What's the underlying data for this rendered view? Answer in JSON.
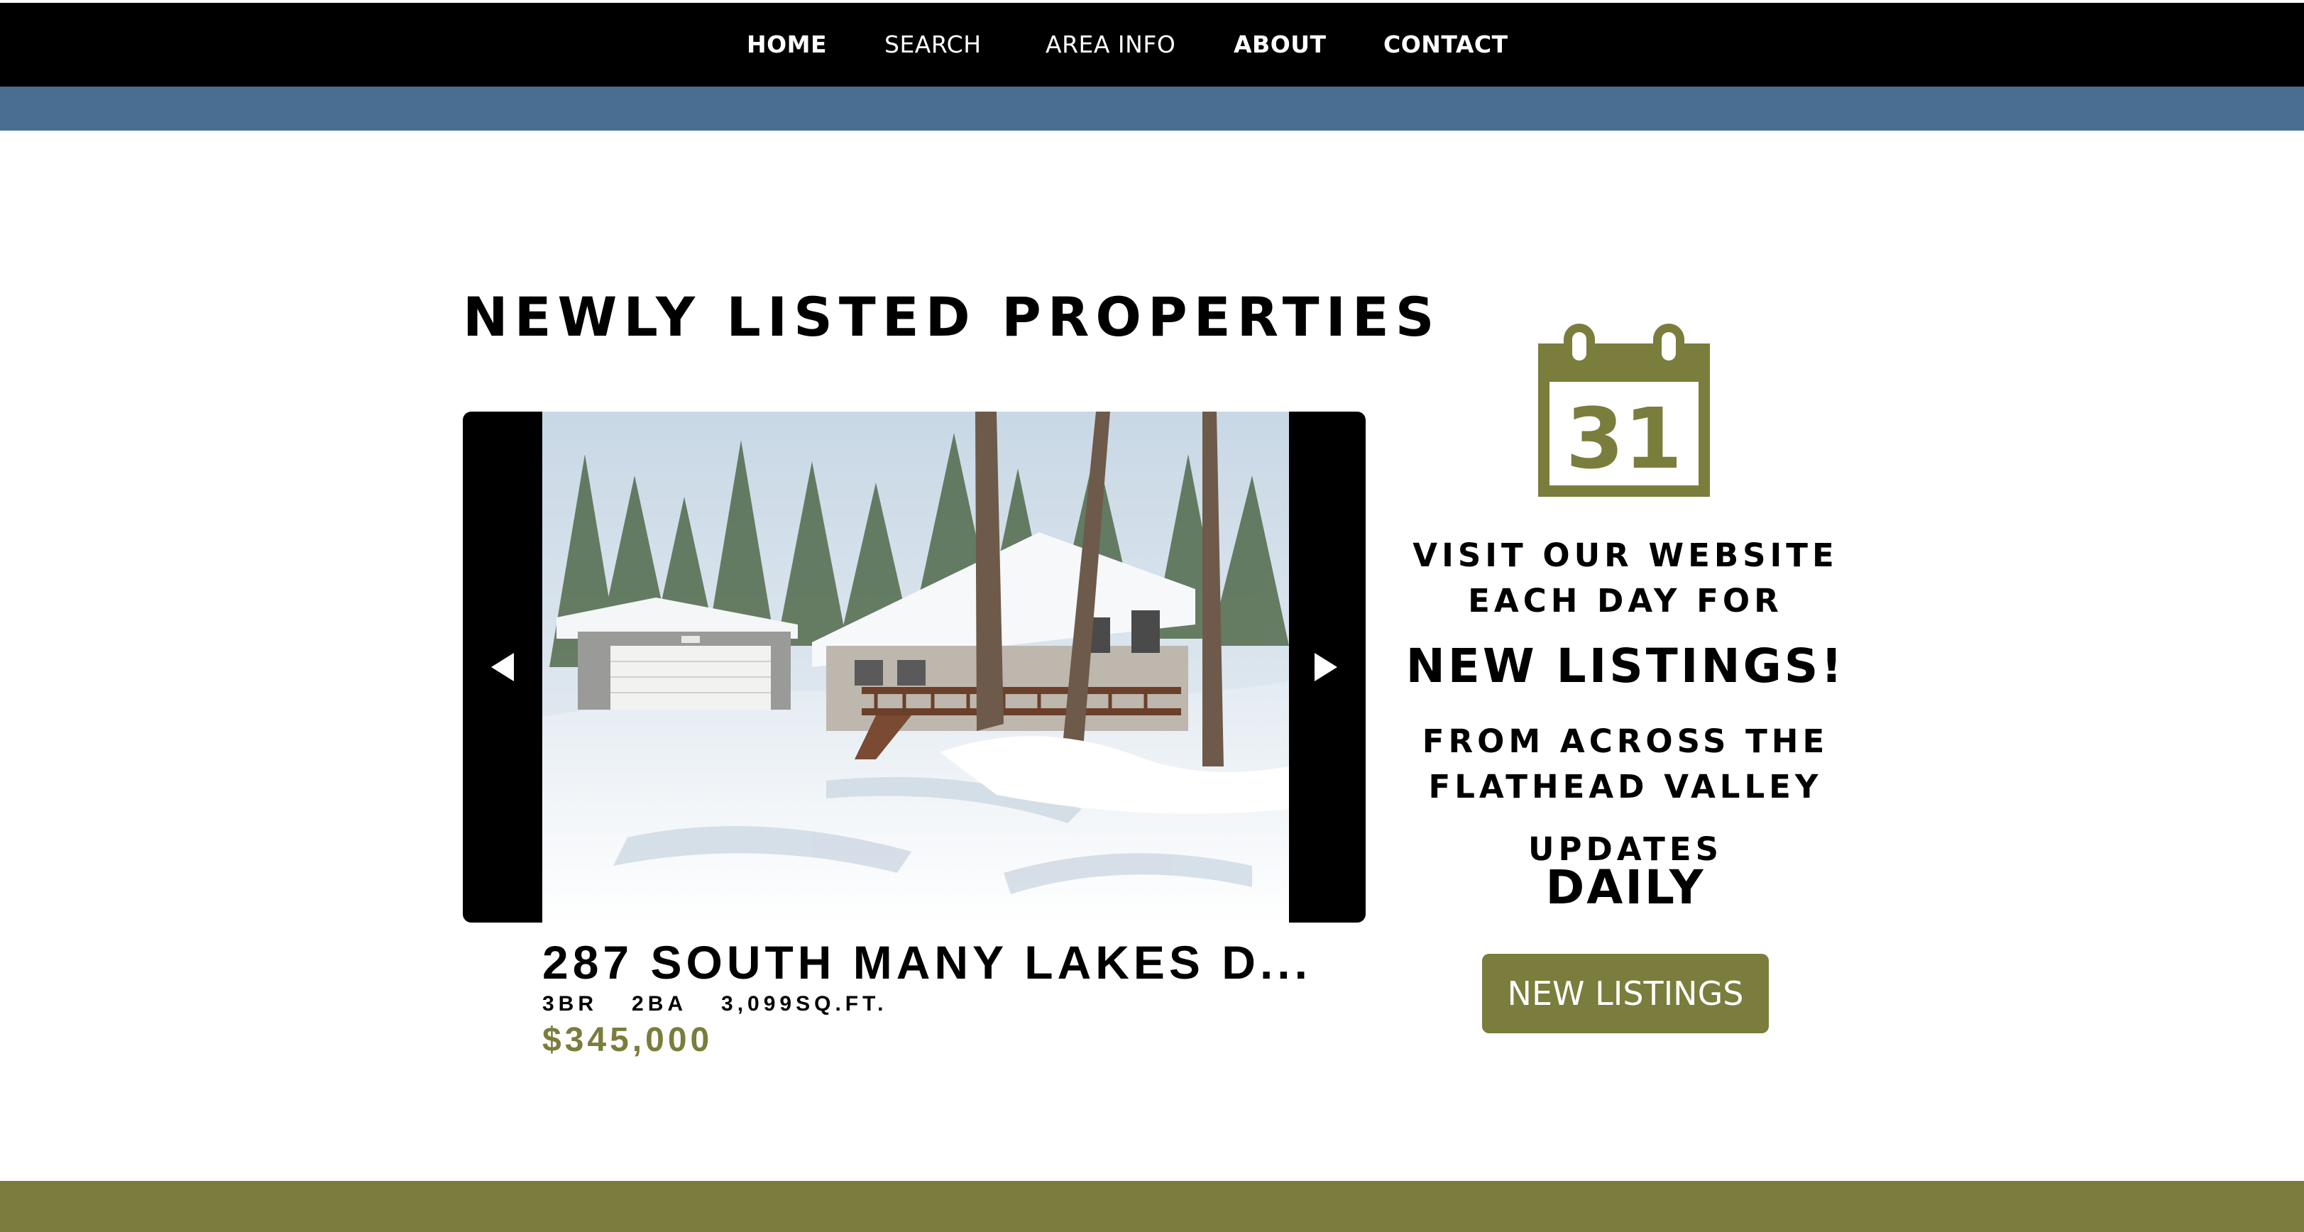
{
  "nav": {
    "items": [
      {
        "label": "HOME"
      },
      {
        "label": "SEARCH"
      },
      {
        "label": "AREA INFO"
      },
      {
        "label": "ABOUT"
      },
      {
        "label": "CONTACT"
      }
    ]
  },
  "section": {
    "title": "NEWLY LISTED PROPERTIES"
  },
  "listing": {
    "address": "287 SOUTH MANY LAKES D...",
    "beds": "3BR",
    "baths": "2BA",
    "sqft": "3,099SQ.FT.",
    "price": "$345,000"
  },
  "promo": {
    "calendar_day": "31",
    "line1": "VISIT OUR WEBSITE",
    "line2": "EACH DAY FOR",
    "line3": "NEW LISTINGS!",
    "line4": "FROM ACROSS THE",
    "line5": "FLATHEAD VALLEY",
    "line6": "UPDATES",
    "line7": "DAILY",
    "cta_label": "NEW LISTINGS"
  },
  "icons": {
    "prev": "chevron-left-icon",
    "next": "chevron-right-icon",
    "calendar": "calendar-icon"
  },
  "colors": {
    "nav_bg": "#000000",
    "band_blue": "#4a6d92",
    "accent_olive": "#7a7d3c"
  }
}
